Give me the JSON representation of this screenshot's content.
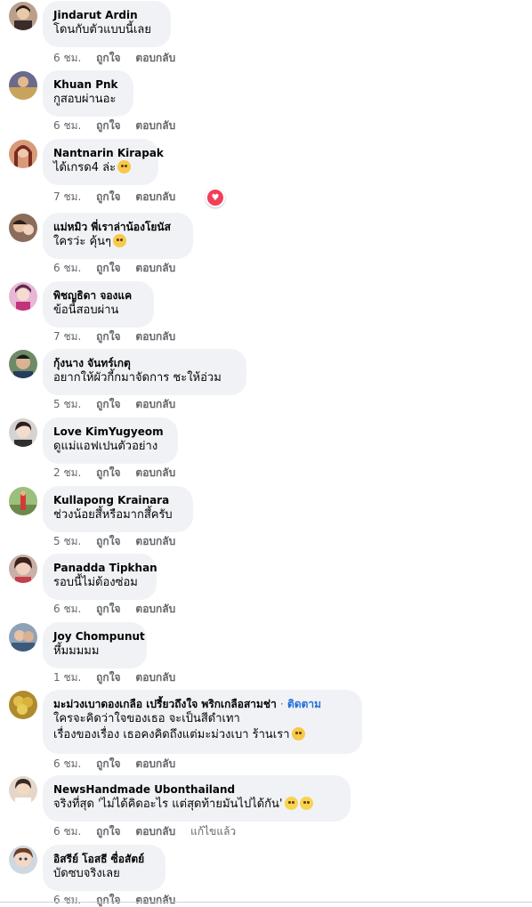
{
  "actions": {
    "like": "ถูกใจ",
    "reply": "ตอบกลับ",
    "edited": "แก้ไขแล้ว"
  },
  "comments": [
    {
      "author": "Jindarut Ardin",
      "lines": [
        "โดนกับตัวแบบนี้เลย"
      ],
      "time": "6 ชม."
    },
    {
      "author": "Khuan Pnk",
      "lines": [
        "กูสอบผ่านอะ"
      ],
      "time": "6 ชม."
    },
    {
      "author": "Nantnarin Kirapak",
      "lines": [
        "ได้เกรด4 ล่ะ"
      ],
      "time": "7 ชม.",
      "reaction": "heart"
    },
    {
      "author": "แม่หมิว พี่เราล่าน้องโยนัส",
      "lines": [
        "ใครว่ะ คุ้นๆ"
      ],
      "time": "6 ชม."
    },
    {
      "author": "พิชญธิดา จองแค",
      "lines": [
        "ข้อนี้สอบผ่าน"
      ],
      "time": "7 ชม."
    },
    {
      "author": "กุ้งนาง จันทร์เกตุ",
      "lines": [
        "อยากให้ผัวกี้กมาจัดการ ชะให้อ่วม"
      ],
      "time": "5 ชม."
    },
    {
      "author": "Love KimYugyeom",
      "lines": [
        "ดูแม่แอฟเปนตัวอย่าง"
      ],
      "time": "2 ชม."
    },
    {
      "author": "Kullapong Krainara",
      "lines": [
        "ช่วงน้อยสึ้หรือมากสึ้ครับ"
      ],
      "time": "5 ชม."
    },
    {
      "author": "Panadda Tipkhan",
      "lines": [
        "รอบนี้ไม่ต้องซ่อม"
      ],
      "time": "6 ชม."
    },
    {
      "author": "Joy Chompunut",
      "lines": [
        "หึ้มมมมม"
      ],
      "time": "1 ชม."
    },
    {
      "author": "มะม่วงเบาดองเกลือ เปรี้ยวถึงใจ พริกเกลือสามช่า",
      "follow": "ติดตาม",
      "lines": [
        "ใครจะคิดว่าใจของเธอ จะเป็นสีดำเทา",
        "เรื่องของเรื่อง เธอคงคิดถึงแต่มะม่วงเบา ร้านเรา"
      ],
      "time": "6 ชม."
    },
    {
      "author": "NewsHandmade Ubonthailand",
      "lines": [
        "จริงที่สุด 'ไม่ได้คิดอะไร แต่สุดท้ายมันไปได้กัน'"
      ],
      "time": "6 ชม.",
      "edited": true
    },
    {
      "author": "อิสรีย์ โอสธี ซื่อสัตย์",
      "lines": [
        "บัดซบจริงเลย"
      ],
      "time": "6 ชม."
    }
  ]
}
